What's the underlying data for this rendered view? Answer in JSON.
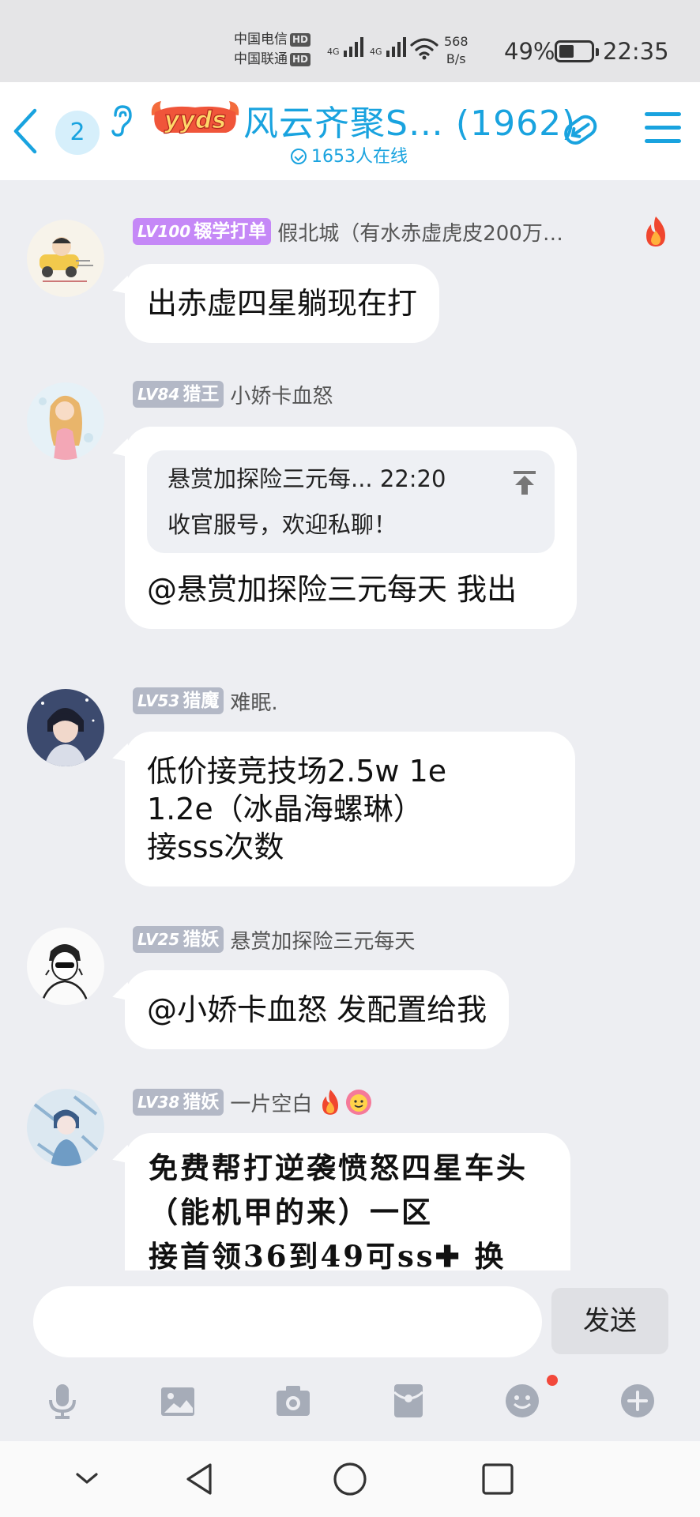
{
  "status_bar": {
    "carrier1": "中国电信",
    "carrier2": "中国联通",
    "hd_badge": "HD",
    "net_type": "4G",
    "speed_value": "568",
    "speed_unit": "B/s",
    "battery_pct": "49%",
    "time": "22:35"
  },
  "header": {
    "unread_count": "2",
    "logo_text": "yyds",
    "title": "风云齐聚S… (1962)",
    "online": "1653人在线"
  },
  "messages": [
    {
      "level": "LV100",
      "title": "辍学打单",
      "name": "假北城（有水赤虚虎皮200万…",
      "text": "出赤虚四星躺现在打"
    },
    {
      "level": "LV84",
      "title": "猎王",
      "name": "小娇卡血怒",
      "reply_header": "悬赏加探险三元每... 22:20",
      "reply_text": "收官服号，欢迎私聊！",
      "text": "@悬赏加探险三元每天 我出"
    },
    {
      "level": "LV53",
      "title": "猎魔",
      "name": "难眠.",
      "lines": [
        "低价接竞技场2.5w 1e",
        "1.2e（冰晶海螺琳）",
        "接sss次数"
      ]
    },
    {
      "level": "LV25",
      "title": "猎妖",
      "name": "悬赏加探险三元每天",
      "text": "@小娇卡血怒 发配置给我"
    },
    {
      "level": "LV38",
      "title": "猎妖",
      "name": "一片空白",
      "lines": [
        "免费帮打逆袭愤怒四星车头",
        "（能机甲的来）一区",
        "接首领36到49可ss✚ 换"
      ]
    }
  ],
  "input": {
    "placeholder": "",
    "send_label": "发送"
  },
  "colors": {
    "accent": "#19a3df",
    "lv_purple": "#c588f7",
    "lv_gray": "#b3b8c6",
    "badge_red": "#f2483b"
  }
}
